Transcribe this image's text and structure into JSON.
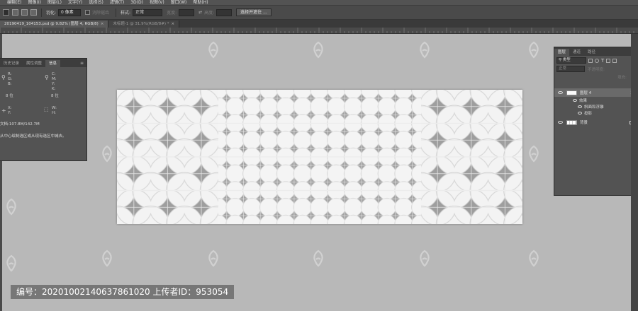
{
  "menubar": {
    "items": [
      "编辑(E)",
      "图像(I)",
      "图层(L)",
      "文字(Y)",
      "选择(S)",
      "滤镜(T)",
      "3D(D)",
      "视图(V)",
      "窗口(W)",
      "帮助(H)"
    ]
  },
  "options": {
    "feather_label": "羽化:",
    "feather_value": "0 像素",
    "antialias_label": "消除锯齿",
    "style_label": "样式:",
    "style_value": "正常",
    "width_label": "宽度:",
    "height_label": "高度:",
    "select_mask_button": "选择并遮住 ..."
  },
  "tabs": [
    {
      "label": "20190419_104153.psd @ 9.82% (图层 4, RGB/8)",
      "active": true
    },
    {
      "label": "未标题-1 @ 31.9%(RGB/8#) *",
      "active": false
    }
  ],
  "info_panel": {
    "tabs": [
      "历史记录",
      "属性调整",
      "信息"
    ],
    "active_tab": "信息",
    "rgb_labels": [
      "R:",
      "G:",
      "B:"
    ],
    "cmyk_labels": [
      "C:",
      "M:",
      "Y:",
      "K:"
    ],
    "bit_left": "8 位",
    "bit_right": "8 位",
    "xy_labels": [
      "X:",
      "Y:"
    ],
    "wh_labels": [
      "W:",
      "H:"
    ],
    "doc_size": "文档:107.8M/142.7M",
    "hint": "从中心绘制选区或从现有选区中减去。"
  },
  "layers_panel": {
    "tabs": [
      "图层",
      "通道",
      "路径"
    ],
    "active_tab": "图层",
    "filter_kind": "类型",
    "blend_mode": "正常",
    "opacity_label": "不透明度:",
    "fill_label": "填充:",
    "layers": [
      {
        "name": "图层 4",
        "selected": true,
        "fx": "fx"
      },
      {
        "name": "效果",
        "sub": true
      },
      {
        "name": "斜面和浮雕",
        "sub": true
      },
      {
        "name": "投影",
        "sub": true
      },
      {
        "name": "背景",
        "selected": false,
        "locked": true
      }
    ]
  },
  "footer": {
    "text": "编号：20201002140637861020 上传者ID：953054"
  },
  "colors": {
    "bg": "#b8b8b8",
    "panel": "#535353",
    "tile_gray": "#9a9a9a",
    "tile_white": "#f4f4f4"
  }
}
